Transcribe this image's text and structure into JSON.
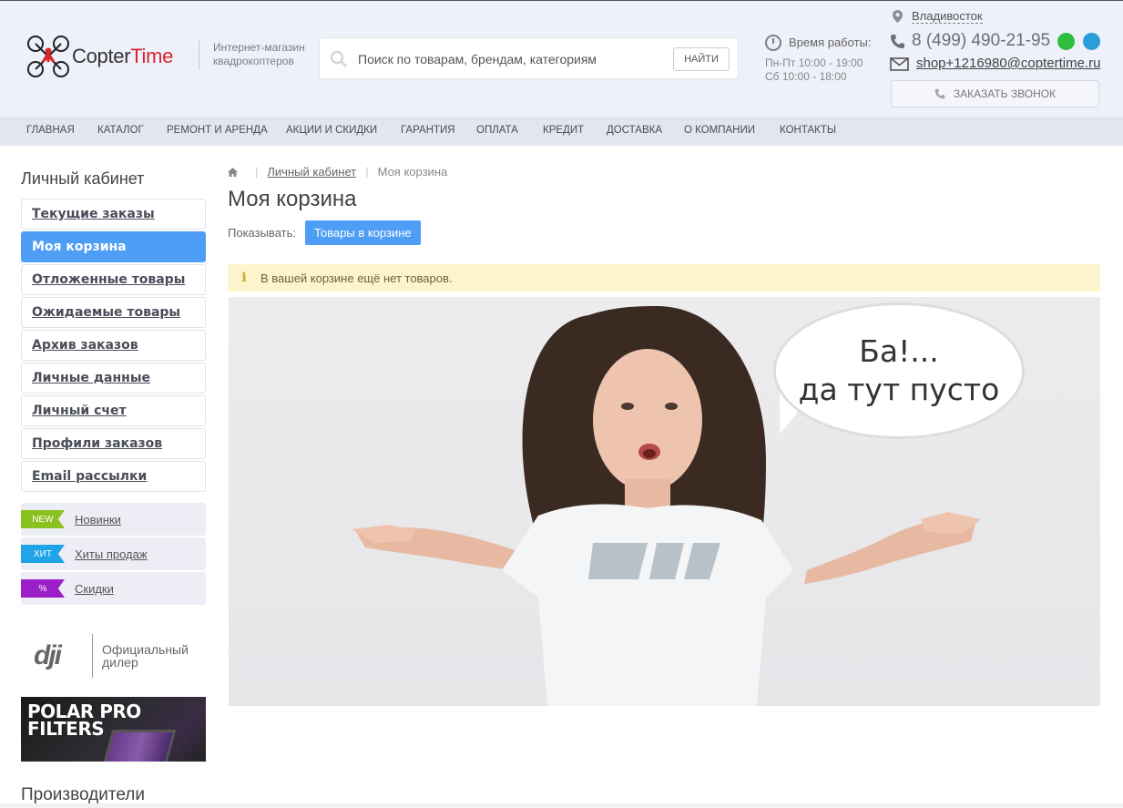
{
  "header": {
    "logo_text_a": "Copter",
    "logo_text_b": "Time",
    "tagline_line1": "Интернет-магазин",
    "tagline_line2": "квадрокоптеров",
    "search_placeholder": "Поиск по товарам, брендам, категориям",
    "search_button": "НАЙТИ",
    "worktime_label": "Время работы:",
    "hours_weekdays": "Пн-Пт 10:00 - 19:00",
    "hours_saturday": "Сб 10:00 - 18:00",
    "city": "Владивосток",
    "phone": "8 (499) 490-21-95",
    "email": "shop+1216980@coptertime.ru",
    "callback_button": "ЗАКАЗАТЬ ЗВОНОК"
  },
  "nav": {
    "items": [
      "ГЛАВНАЯ",
      "КАТАЛОГ",
      "РЕМОНТ И АРЕНДА",
      "АКЦИИ И СКИДКИ",
      "ГАРАНТИЯ",
      "ОПЛАТА",
      "КРЕДИТ",
      "ДОСТАВКА",
      "О КОМПАНИИ",
      "КОНТАКТЫ"
    ]
  },
  "sidebar": {
    "title": "Личный кабинет",
    "items": [
      "Текущие заказы",
      "Моя корзина",
      "Отложенные товары",
      "Ожидаемые товары",
      "Архив заказов",
      "Личные данные",
      "Личный счет",
      "Профили заказов",
      "Email рассылки"
    ],
    "active_index": 1,
    "badges": [
      {
        "tag": "NEW",
        "label": "Новинки",
        "color": "#8cc21f"
      },
      {
        "tag": "ХИТ",
        "label": "Хиты продаж",
        "color": "#1fa4e8"
      },
      {
        "tag": "%",
        "label": "Скидки",
        "color": "#9b1fc7"
      }
    ],
    "dealer_logo": "dji",
    "dealer_line1": "Официальный",
    "dealer_line2": "дилер",
    "banner_line1": "POLAR PRO",
    "banner_line2": "FILTERS",
    "manufacturers_title": "Производители"
  },
  "main": {
    "breadcrumb_item": "Личный кабинет",
    "breadcrumb_current": "Моя корзина",
    "title": "Моя корзина",
    "show_label": "Показывать:",
    "show_button": "Товары в корзине",
    "alert_text": "В вашей корзине ещё нет товаров.",
    "bubble_line1": "Ба!...",
    "bubble_line2": "да тут пусто",
    "shirt_logo": "dji"
  },
  "colors": {
    "accent": "#4e9ef5",
    "brand_red": "#d9262c",
    "header_bg": "#eef0fa",
    "nav_bg": "#e3e5f0"
  }
}
